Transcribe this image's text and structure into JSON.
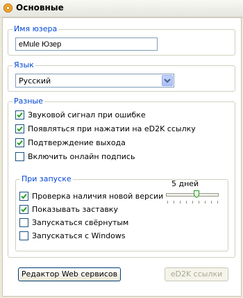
{
  "window": {
    "title": "Основные"
  },
  "username": {
    "legend": "Имя юзера",
    "value": "eMule Юзер"
  },
  "language": {
    "legend": "Язык",
    "selected": "Русский"
  },
  "misc": {
    "legend": "Разные",
    "options": [
      {
        "label": "Звуковой сигнал при ошибке",
        "checked": true
      },
      {
        "label": "Появляться при нажатии на eD2K ссылку",
        "checked": true
      },
      {
        "label": "Подтверждение выхода",
        "checked": true
      },
      {
        "label": "Включить онлайн подпись",
        "checked": false
      }
    ]
  },
  "startup": {
    "legend": "При запуске",
    "options": [
      {
        "label": "Проверка наличия новой версии",
        "checked": true
      },
      {
        "label": "Показывать заставку",
        "checked": true
      },
      {
        "label": "Запускаться свёрнутым",
        "checked": false
      },
      {
        "label": "Запускаться с Windows",
        "checked": false
      }
    ],
    "interval_label": "5 дней",
    "interval_days": 5
  },
  "buttons": {
    "web_services": "Редактор Web сервисов",
    "ed2k_links": "eD2K ссылки"
  },
  "colors": {
    "legend": "#0046d5",
    "check": "#21a121",
    "slider_thumb": "#21a121"
  }
}
